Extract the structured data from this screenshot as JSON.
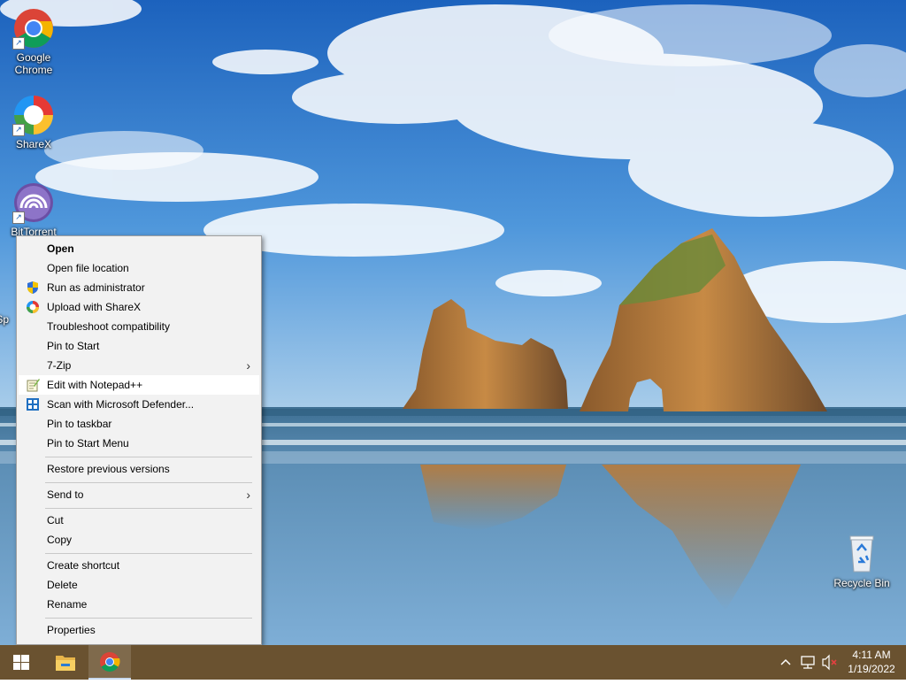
{
  "desktop": {
    "icons": [
      {
        "label": "Google\nChrome",
        "label1": "Google",
        "label2": "Chrome",
        "icon": "chrome-icon"
      },
      {
        "label": "ShareX",
        "icon": "sharex-icon"
      },
      {
        "label": "BitTorrent",
        "icon": "bittorrent-icon"
      },
      {
        "label": "Sp",
        "icon": "partial-icon"
      }
    ],
    "recycle_bin": {
      "label": "Recycle Bin",
      "icon": "recycle-bin-icon"
    }
  },
  "context_menu": {
    "items": [
      {
        "label": "Open",
        "bold": true
      },
      {
        "label": "Open file location"
      },
      {
        "label": "Run as administrator",
        "icon": "uac-shield-icon"
      },
      {
        "label": "Upload with ShareX",
        "icon": "sharex-icon"
      },
      {
        "label": "Troubleshoot compatibility"
      },
      {
        "label": "Pin to Start"
      },
      {
        "label": "7-Zip",
        "submenu": true
      },
      {
        "label": "Edit with Notepad++",
        "icon": "notepadpp-icon",
        "highlighted": true
      },
      {
        "label": "Scan with Microsoft Defender...",
        "icon": "defender-icon"
      },
      {
        "label": "Pin to taskbar"
      },
      {
        "label": "Pin to Start Menu"
      },
      {
        "label": "Restore previous versions"
      },
      {
        "label": "Send to",
        "submenu": true
      },
      {
        "label": "Cut"
      },
      {
        "label": "Copy"
      },
      {
        "label": "Create shortcut"
      },
      {
        "label": "Delete"
      },
      {
        "label": "Rename"
      },
      {
        "label": "Properties"
      }
    ],
    "submenu_arrow": "›"
  },
  "taskbar": {
    "buttons": [
      {
        "name": "start",
        "icon": "windows-logo-icon"
      },
      {
        "name": "file-explorer",
        "icon": "folder-icon"
      },
      {
        "name": "chrome",
        "icon": "chrome-icon",
        "active": true
      }
    ],
    "tray": {
      "chevron": "^",
      "icons": [
        "network-icon",
        "volume-muted-icon"
      ]
    },
    "clock": {
      "time": "4:11 AM",
      "date": "1/19/2022"
    }
  },
  "colors": {
    "taskbar": "#6a5230",
    "menu_bg": "#f2f2f2",
    "menu_hover": "#ffffff",
    "chrome_red": "#db4437",
    "chrome_yellow": "#f4b400",
    "chrome_green": "#0f9d58",
    "chrome_blue": "#4285f4"
  }
}
